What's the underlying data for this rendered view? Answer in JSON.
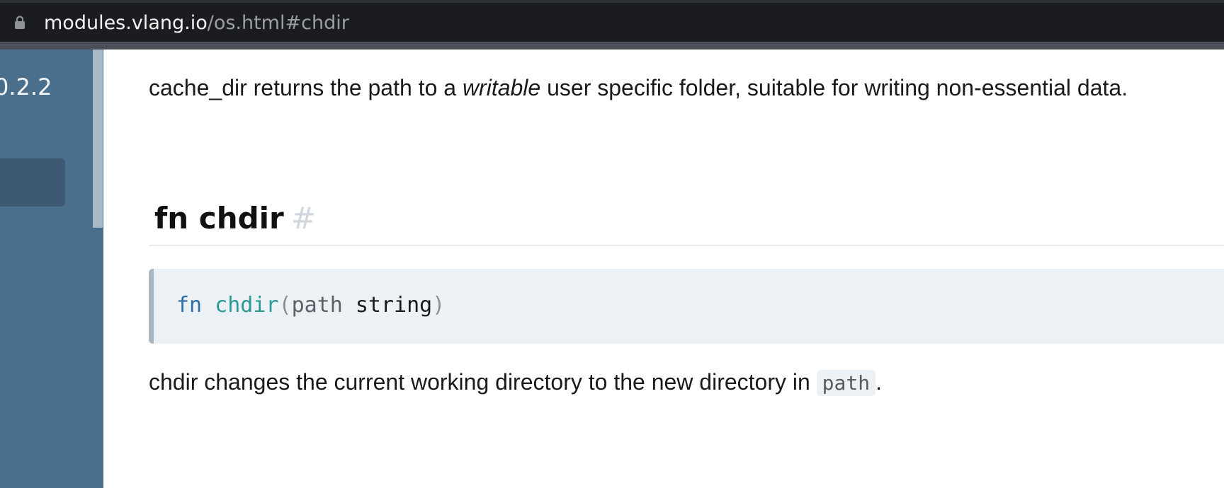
{
  "browser": {
    "url_host": "modules.vlang.io",
    "url_path": "/os.html#chdir",
    "lock_icon": "lock-icon"
  },
  "sidebar": {
    "version": "0.2.2"
  },
  "content": {
    "cache_dir_desc": {
      "before": "cache_dir returns the path to a ",
      "emphasis": "writable",
      "after": " user specific folder, suitable for writing non-essential data."
    },
    "fn_heading": {
      "title": "fn chdir",
      "anchor": "#"
    },
    "signature": {
      "keyword": "fn",
      "name": "chdir",
      "open_paren": "(",
      "param_name": "path",
      "param_type": "string",
      "close_paren": ")"
    },
    "chdir_desc": {
      "before": "chdir changes the current working directory to the new directory in ",
      "code": "path",
      "after": "."
    }
  },
  "colors": {
    "sidebar_bg": "#4a6f8c",
    "code_bg": "#ecf1f5",
    "keyword": "#2f6fa8",
    "function_name": "#2a9a94"
  }
}
